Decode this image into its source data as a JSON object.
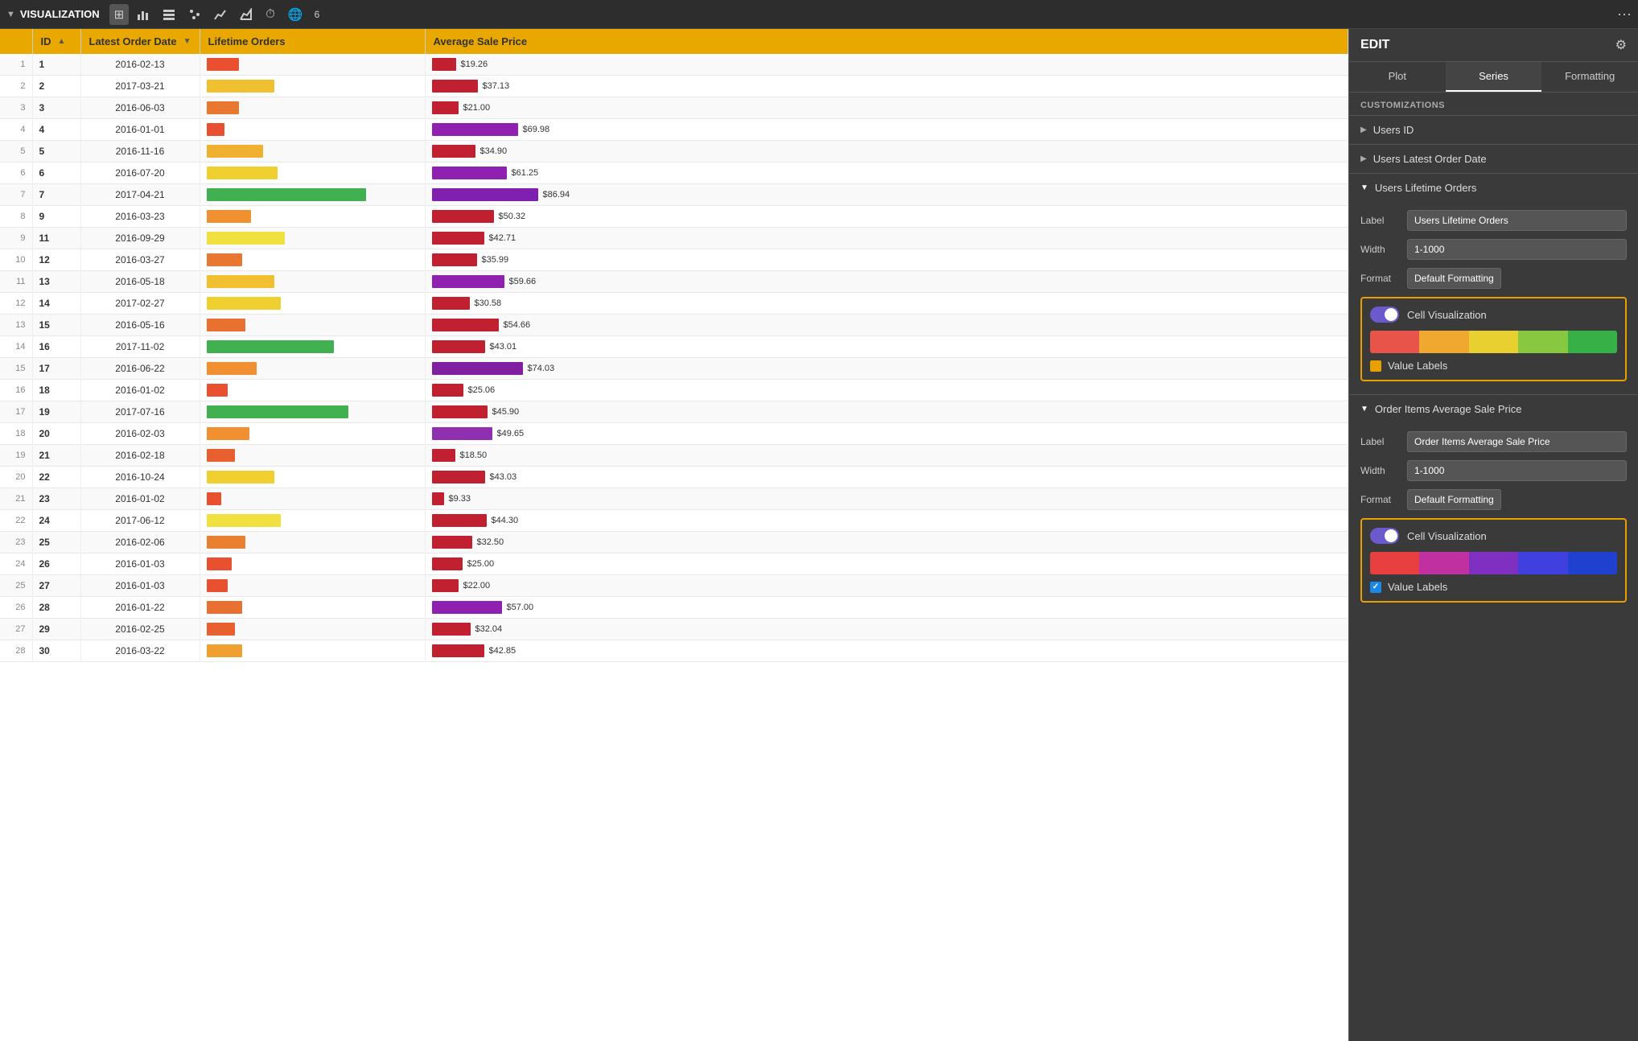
{
  "toolbar": {
    "title": "VISUALIZATION",
    "icons": [
      "grid",
      "bar-chart",
      "list",
      "pie",
      "line",
      "area",
      "clock",
      "globe",
      "number"
    ],
    "more_label": "···"
  },
  "panel": {
    "title": "EDIT",
    "tabs": [
      "Plot",
      "Series",
      "Formatting"
    ],
    "active_tab": "Series",
    "customizations_label": "CUSTOMIZATIONS",
    "sections": [
      {
        "id": "users-id",
        "label": "Users ID",
        "expanded": false
      },
      {
        "id": "users-latest-order-date",
        "label": "Users Latest Order Date",
        "expanded": false
      },
      {
        "id": "users-lifetime-orders",
        "label": "Users Lifetime Orders",
        "expanded": true,
        "fields": {
          "label_label": "Label",
          "label_value": "Users Lifetime Orders",
          "width_label": "Width",
          "width_value": "1-1000",
          "format_label": "Format",
          "format_value": "Default Formatting"
        },
        "cell_viz_label": "Cell Visualization",
        "value_labels_label": "Value Labels",
        "value_labels_checked": false,
        "color_segments": [
          "#e8534a",
          "#f0a830",
          "#e8d030",
          "#88c840",
          "#38b048"
        ]
      },
      {
        "id": "order-items-avg-sale-price",
        "label": "Order Items Average Sale Price",
        "expanded": true,
        "fields": {
          "label_label": "Label",
          "label_value": "Order Items Average Sale Price",
          "width_label": "Width",
          "width_value": "1-1000",
          "format_label": "Format",
          "format_value": "Default Formatting"
        },
        "cell_viz_label": "Cell Visualization",
        "value_labels_label": "Value Labels",
        "value_labels_checked": true,
        "color_segments": [
          "#e84040",
          "#c030a0",
          "#8030c0",
          "#4040e0",
          "#2040d0"
        ]
      }
    ]
  },
  "table": {
    "columns": [
      "ID",
      "Latest Order Date",
      "Lifetime Orders",
      "Average Sale Price"
    ],
    "rows": [
      {
        "row_num": 1,
        "id": "1",
        "date": "2016-02-13",
        "orders_bar": 0.18,
        "orders_color": "#e85030",
        "price": 19.26,
        "price_color": "#c02030",
        "price_bar": 0.2
      },
      {
        "row_num": 2,
        "id": "2",
        "date": "2017-03-21",
        "orders_bar": 0.38,
        "orders_color": "#f0c030",
        "price": 37.13,
        "price_color": "#c02030",
        "price_bar": 0.38
      },
      {
        "row_num": 3,
        "id": "3",
        "date": "2016-06-03",
        "orders_bar": 0.18,
        "orders_color": "#e87830",
        "price": 21.0,
        "price_color": "#c02030",
        "price_bar": 0.22
      },
      {
        "row_num": 4,
        "id": "4",
        "date": "2016-01-01",
        "orders_bar": 0.1,
        "orders_color": "#e85030",
        "price": 69.98,
        "price_color": "#9020b0",
        "price_bar": 0.71
      },
      {
        "row_num": 5,
        "id": "5",
        "date": "2016-11-16",
        "orders_bar": 0.32,
        "orders_color": "#f0b030",
        "price": 34.9,
        "price_color": "#c02030",
        "price_bar": 0.36
      },
      {
        "row_num": 6,
        "id": "6",
        "date": "2016-07-20",
        "orders_bar": 0.4,
        "orders_color": "#f0d030",
        "price": 61.25,
        "price_color": "#9020b0",
        "price_bar": 0.62
      },
      {
        "row_num": 7,
        "id": "7",
        "date": "2017-04-21",
        "orders_bar": 0.9,
        "orders_color": "#40b050",
        "price": 86.94,
        "price_color": "#8020b0",
        "price_bar": 0.88
      },
      {
        "row_num": 8,
        "id": "9",
        "date": "2016-03-23",
        "orders_bar": 0.25,
        "orders_color": "#f09030",
        "price": 50.32,
        "price_color": "#c02030",
        "price_bar": 0.51
      },
      {
        "row_num": 9,
        "id": "11",
        "date": "2016-09-29",
        "orders_bar": 0.44,
        "orders_color": "#f0e040",
        "price": 42.71,
        "price_color": "#c02030",
        "price_bar": 0.43
      },
      {
        "row_num": 10,
        "id": "12",
        "date": "2016-03-27",
        "orders_bar": 0.2,
        "orders_color": "#e87830",
        "price": 35.99,
        "price_color": "#c02030",
        "price_bar": 0.37
      },
      {
        "row_num": 11,
        "id": "13",
        "date": "2016-05-18",
        "orders_bar": 0.38,
        "orders_color": "#f0c030",
        "price": 59.66,
        "price_color": "#9020b0",
        "price_bar": 0.6
      },
      {
        "row_num": 12,
        "id": "14",
        "date": "2017-02-27",
        "orders_bar": 0.42,
        "orders_color": "#f0d030",
        "price": 30.58,
        "price_color": "#c02030",
        "price_bar": 0.31
      },
      {
        "row_num": 13,
        "id": "15",
        "date": "2016-05-16",
        "orders_bar": 0.22,
        "orders_color": "#e87030",
        "price": 54.66,
        "price_color": "#c02030",
        "price_bar": 0.55
      },
      {
        "row_num": 14,
        "id": "16",
        "date": "2017-11-02",
        "orders_bar": 0.72,
        "orders_color": "#40b050",
        "price": 43.01,
        "price_color": "#c02030",
        "price_bar": 0.44
      },
      {
        "row_num": 15,
        "id": "17",
        "date": "2016-06-22",
        "orders_bar": 0.28,
        "orders_color": "#f09030",
        "price": 74.03,
        "price_color": "#8020a0",
        "price_bar": 0.75
      },
      {
        "row_num": 16,
        "id": "18",
        "date": "2016-01-02",
        "orders_bar": 0.12,
        "orders_color": "#e85030",
        "price": 25.06,
        "price_color": "#c02030",
        "price_bar": 0.26
      },
      {
        "row_num": 17,
        "id": "19",
        "date": "2017-07-16",
        "orders_bar": 0.8,
        "orders_color": "#40b050",
        "price": 45.9,
        "price_color": "#c02030",
        "price_bar": 0.46
      },
      {
        "row_num": 18,
        "id": "20",
        "date": "2016-02-03",
        "orders_bar": 0.24,
        "orders_color": "#f09030",
        "price": 49.65,
        "price_color": "#9030b0",
        "price_bar": 0.5
      },
      {
        "row_num": 19,
        "id": "21",
        "date": "2016-02-18",
        "orders_bar": 0.16,
        "orders_color": "#e86030",
        "price": 18.5,
        "price_color": "#c02030",
        "price_bar": 0.19
      },
      {
        "row_num": 20,
        "id": "22",
        "date": "2016-10-24",
        "orders_bar": 0.38,
        "orders_color": "#f0d030",
        "price": 43.03,
        "price_color": "#c02030",
        "price_bar": 0.44
      },
      {
        "row_num": 21,
        "id": "23",
        "date": "2016-01-02",
        "orders_bar": 0.08,
        "orders_color": "#e85030",
        "price": 9.33,
        "price_color": "#c02030",
        "price_bar": 0.1
      },
      {
        "row_num": 22,
        "id": "24",
        "date": "2017-06-12",
        "orders_bar": 0.42,
        "orders_color": "#f0e040",
        "price": 44.3,
        "price_color": "#c02030",
        "price_bar": 0.45
      },
      {
        "row_num": 23,
        "id": "25",
        "date": "2016-02-06",
        "orders_bar": 0.22,
        "orders_color": "#e88030",
        "price": 32.5,
        "price_color": "#c02030",
        "price_bar": 0.33
      },
      {
        "row_num": 24,
        "id": "26",
        "date": "2016-01-03",
        "orders_bar": 0.14,
        "orders_color": "#e85030",
        "price": 25.0,
        "price_color": "#c02030",
        "price_bar": 0.25
      },
      {
        "row_num": 25,
        "id": "27",
        "date": "2016-01-03",
        "orders_bar": 0.12,
        "orders_color": "#e85030",
        "price": 22.0,
        "price_color": "#c02030",
        "price_bar": 0.22
      },
      {
        "row_num": 26,
        "id": "28",
        "date": "2016-01-22",
        "orders_bar": 0.2,
        "orders_color": "#e87030",
        "price": 57.0,
        "price_color": "#9020b0",
        "price_bar": 0.58
      },
      {
        "row_num": 27,
        "id": "29",
        "date": "2016-02-25",
        "orders_bar": 0.16,
        "orders_color": "#e86030",
        "price": 32.04,
        "price_color": "#c02030",
        "price_bar": 0.32
      },
      {
        "row_num": 28,
        "id": "30",
        "date": "2016-03-22",
        "orders_bar": 0.2,
        "orders_color": "#f0a030",
        "price": 42.85,
        "price_color": "#c02030",
        "price_bar": 0.43
      }
    ]
  }
}
